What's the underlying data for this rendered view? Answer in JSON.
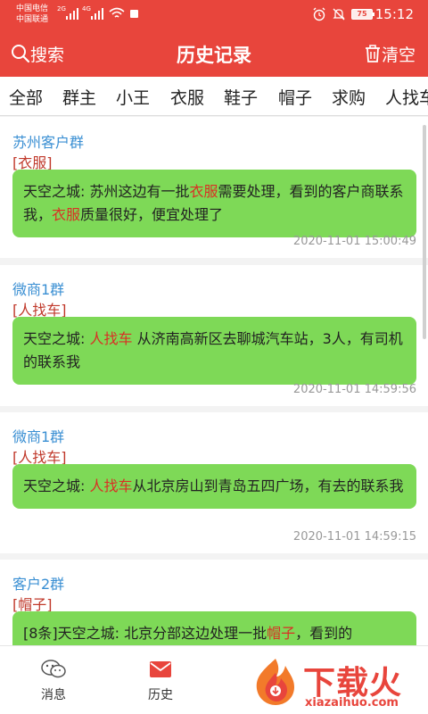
{
  "status": {
    "carrier1": "中国电信",
    "carrier2": "中国联通",
    "sig_tag1": "2G",
    "sig_tag2": "4G",
    "battery": "75",
    "time": "15:12"
  },
  "header": {
    "search_label": "搜索",
    "title": "历史记录",
    "clear_label": "清空"
  },
  "tabs": [
    "全部",
    "群主",
    "小王",
    "衣服",
    "鞋子",
    "帽子",
    "求购",
    "人找车"
  ],
  "messages": [
    {
      "group": "苏州客户群",
      "category": "[衣服]",
      "parts": [
        "天空之城: 苏州这边有一批",
        "衣服",
        "需要处理，看到的客户商联系我，",
        "衣服",
        "质量很好，便宜处理了"
      ],
      "time": "2020-11-01 15:00:49"
    },
    {
      "group": "微商1群",
      "category": "[人找车]",
      "parts": [
        "天空之城: ",
        "人找车",
        " 从济南高新区去聊城汽车站，3人，有司机的联系我"
      ],
      "time": "2020-11-01 14:59:56"
    },
    {
      "group": "微商1群",
      "category": "[人找车]",
      "parts": [
        "天空之城: ",
        "人找车",
        "从北京房山到青岛五四广场，有去的联系我"
      ],
      "time": "2020-11-01 14:59:15"
    },
    {
      "group": "客户2群",
      "category": "[帽子]",
      "parts": [
        "[8条]天空之城: 北京分部这边处理一批",
        "帽子",
        "，看到的"
      ]
    }
  ],
  "bottom_nav": {
    "messages_label": "消息",
    "history_label": "历史"
  },
  "watermark": {
    "text": "下载火",
    "url": "xiazaihuo.com"
  },
  "colors": {
    "accent": "#e8453c",
    "bubble": "#7ed957",
    "group_text": "#3a8fd3",
    "keyword": "#d93025"
  }
}
